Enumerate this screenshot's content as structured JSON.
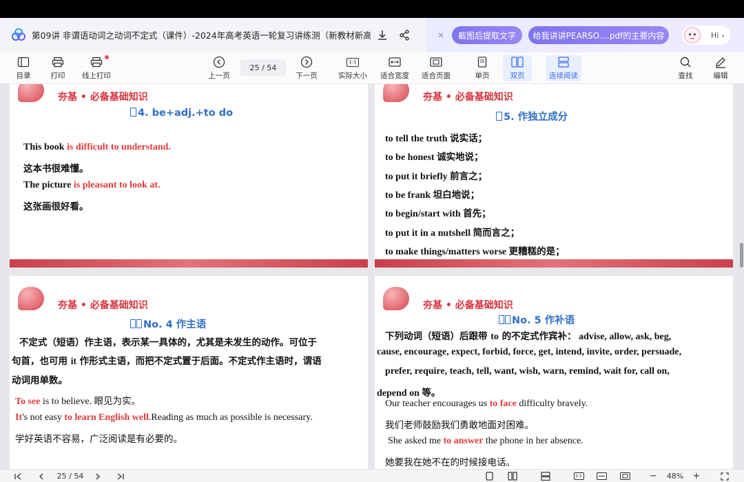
{
  "titlebar": {
    "title": "第09讲 非谓语动词之动词不定式（课件）-2024年高考英语一轮复习讲练测（新教材新高考...",
    "ai_pill_1": "截图后提取文字",
    "ai_pill_2": "给我讲讲PEARSO....pdf的主要内容",
    "ai_hi": "Hi",
    "close_glyph": "×"
  },
  "toolbar": {
    "catalog": "目录",
    "print": "打印",
    "online_print": "线上打印",
    "prev": "上一页",
    "page_indicator": "25 / 54",
    "next": "下一页",
    "actual_size": "实际大小",
    "fit_width": "适合宽度",
    "fit_page": "适合页面",
    "single": "单页",
    "double": "双页",
    "continuous": "连续阅读",
    "find": "查找",
    "edit": "编辑",
    "actual_icon_text": "1:1"
  },
  "pages": {
    "p1": {
      "header": "夯基 • 必备基础知识",
      "subtitle": "4.  be+adj.+to do",
      "l1_a": "This book ",
      "l1_b": "is difficult to understand.",
      "l2": "这本书很难懂。",
      "l3_a": "The picture ",
      "l3_b": "is pleasant to look at.",
      "l4": "这张画很好看。"
    },
    "p2": {
      "header": "夯基 • 必备基础知识",
      "subtitle": "5.   作独立成分",
      "items": [
        {
          "en": "to tell the truth ",
          "cn": "说实话；"
        },
        {
          "en": "to be honest ",
          "cn": "诚实地说；"
        },
        {
          "en": "to put it briefly ",
          "cn": "前言之；"
        },
        {
          "en": "to be frank ",
          "cn": "坦白地说；"
        },
        {
          "en": "to begin/start with ",
          "cn": "首先；"
        },
        {
          "en": "to put it in a nutshell ",
          "cn": "简而言之；"
        },
        {
          "en": "to make things/matters worse ",
          "cn": "更糟糕的是；"
        }
      ]
    },
    "p3": {
      "header": "夯基 • 必备基础知识",
      "subtitle": "No. 4    作主语",
      "para1": "不定式（短语）作主语，表示某一具体的，尤其是未发生的动作。可位于",
      "para2_a": "句首，也可用 ",
      "para2_b": "it",
      "para2_c": " 作形式主语，而把不定式置于后面。不定式作主语时，谓语",
      "para3": "动词用单数。",
      "ex1_a": "To see",
      "ex1_b": " is to believe.  ",
      "ex1_c": "眼见为实。",
      "ex2_a": "It",
      "ex2_b": "'s not easy ",
      "ex2_c": "to learn English well",
      "ex2_d": ".Reading as much as possible is necessary.",
      "ex3": "学好英语不容易，广泛阅读是有必要的。"
    },
    "p4": {
      "header": "夯基 • 必备基础知识",
      "subtitle": "No. 5    作补语",
      "para1_a": "下列动词（短语）后跟带 ",
      "para1_b": "to",
      "para1_c": " 的不定式作宾补：",
      "para1_d": " advise, allow, ask, beg,",
      "para2": "cause, encourage, expect, forbid, force, get, intend, invite, order, persuade,",
      "para3": "prefer, require, teach, tell, want, wish, warn, remind, wait for, call on,",
      "para4_a": "depend on ",
      "para4_b": "等。",
      "ex1_a": "Our teacher encourages us ",
      "ex1_b": "to face",
      "ex1_c": " difficulty bravely.",
      "ex2": "我们老师鼓励我们勇敢地面对困难。",
      "ex3_a": "She asked me ",
      "ex3_b": "to answer",
      "ex3_c": " the phone in her absence.",
      "ex4": "她要我在她不在的时候接电话。"
    }
  },
  "statusbar": {
    "page_indicator": "25 / 54",
    "zoom": "48%",
    "minus": "−",
    "plus": "+",
    "actual_icon_text": "1:1"
  },
  "colors": {
    "accent": "#3a6bf0",
    "heading_red": "#d8333d",
    "subtitle_blue": "#2f6fc7",
    "emphasis_red": "#e03a3a"
  }
}
